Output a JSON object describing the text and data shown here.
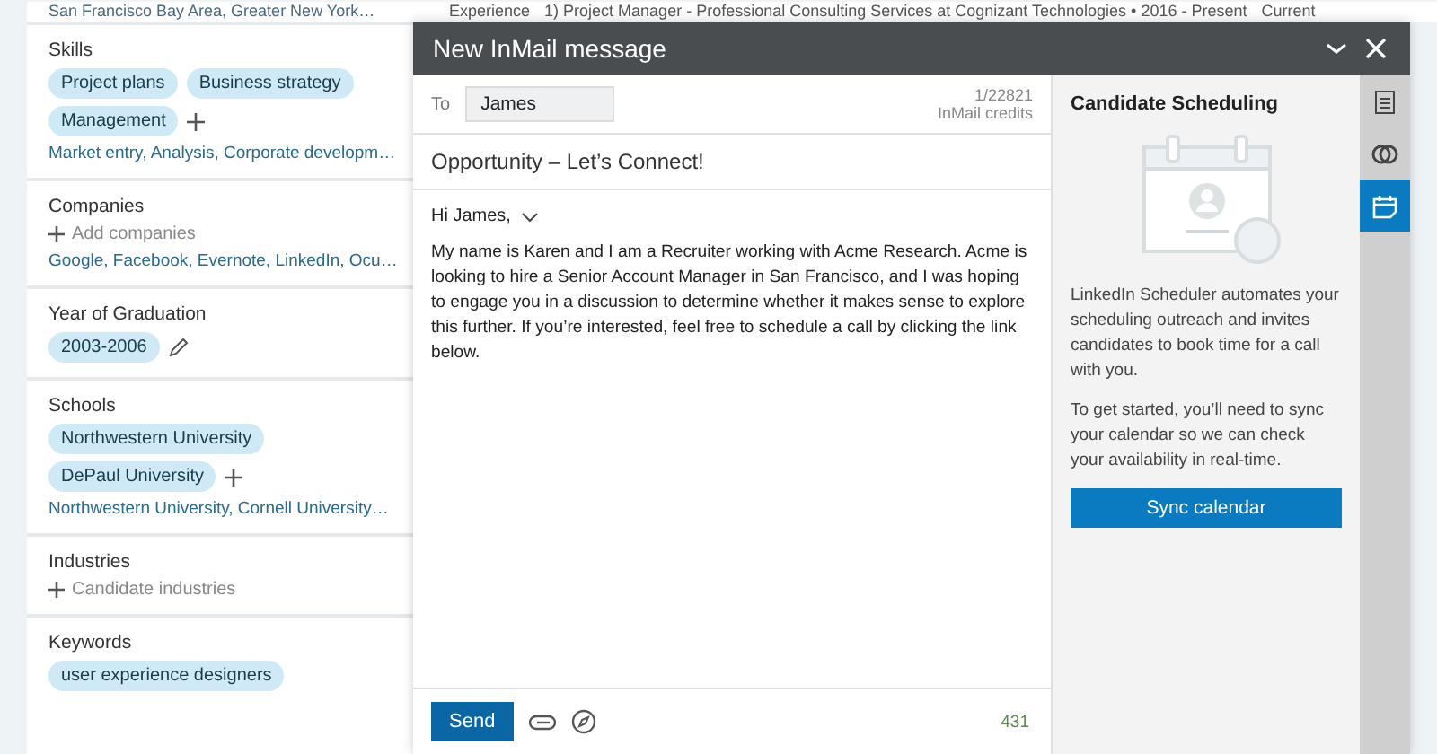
{
  "background": {
    "location": "San Francisco Bay Area, Greater New York…",
    "experience_label": "Experience",
    "experience_text": "1) Project Manager - Professional Consulting Services at Cognizant Technologies • 2016 - Present",
    "current": "Current"
  },
  "filters": [
    {
      "title": "Skills",
      "pills": [
        "Project plans",
        "Business strategy",
        "Management"
      ],
      "addable": true,
      "summary": "Market entry, Analysis, Corporate developm…"
    },
    {
      "title": "Companies",
      "add_text": "Add companies",
      "summary": "Google, Facebook, Evernote, LinkedIn, Ocu…"
    },
    {
      "title": "Year of Graduation",
      "pills": [
        "2003-2006"
      ],
      "editable": true
    },
    {
      "title": "Schools",
      "pills": [
        "Northwestern University",
        "DePaul University"
      ],
      "addable": true,
      "summary": "Northwestern University, Cornell University…"
    },
    {
      "title": "Industries",
      "add_text": "Candidate industries"
    },
    {
      "title": "Keywords",
      "pills": [
        "user experience designers"
      ]
    }
  ],
  "message": {
    "title": "New InMail message",
    "to_label": "To",
    "to_value": "James",
    "credits": "1/22821",
    "credits_label": "InMail credits",
    "subject": "Opportunity – Let’s Connect!",
    "greeting": "Hi James,",
    "body": "My name is Karen and I am a Recruiter working with Acme Research. Acme is looking to hire a Senior Account Manager in San Francisco, and I was hoping to engage you in a discussion to determine whether it makes sense to explore this further. If you’re interested, feel free to schedule a call by clicking the link below.",
    "send": "Send",
    "count": "431"
  },
  "scheduling": {
    "title": "Candidate Scheduling",
    "paragraphs": [
      "LinkedIn Scheduler automates your scheduling outreach and invites candidates to book time for a call with you.",
      "To get started, you’ll need to sync your calendar so we can check your availability in real-time."
    ],
    "button": "Sync calendar"
  },
  "rail": [
    {
      "kind": "notes",
      "selected": false
    },
    {
      "kind": "compare",
      "selected": false
    },
    {
      "kind": "calendar",
      "selected": true
    }
  ]
}
